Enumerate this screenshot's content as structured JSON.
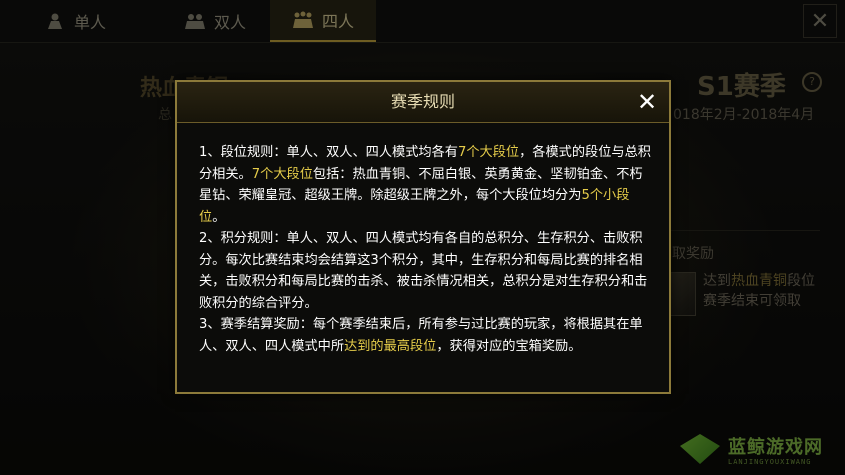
{
  "tabs": [
    {
      "label": "单人",
      "icon": "single-player-icon"
    },
    {
      "label": "双人",
      "icon": "duo-players-icon"
    },
    {
      "label": "四人",
      "icon": "squad-players-icon",
      "active": true
    }
  ],
  "close_main": "✕",
  "background": {
    "rank_title": "热血青铜",
    "rank_sub": "总",
    "season_title": "S1赛季",
    "season_info_icon": "?",
    "season_dates": "018年2月-2018年4月",
    "reward_head": "取奖励",
    "reward_line1_prefix": "达到",
    "reward_line1_highlight": "热血青铜",
    "reward_line1_suffix": "段位",
    "reward_line2": "赛季结束可领取"
  },
  "modal": {
    "title": "赛季规则",
    "close": "✕",
    "rules": [
      {
        "parts": [
          {
            "t": "1、段位规则：单人、双人、四人模式均各有"
          },
          {
            "t": "7个大段位",
            "hl": true
          },
          {
            "t": "，各模式的段位与总积分相关。"
          },
          {
            "t": "7个大段位",
            "hl": true
          },
          {
            "t": "包括：热血青铜、不屈白银、英勇黄金、坚韧铂金、不朽星钻、荣耀皇冠、超级王牌。除超级王牌之外，每个大段位均分为"
          },
          {
            "t": "5个小段位",
            "hl": true
          },
          {
            "t": "。"
          }
        ]
      },
      {
        "parts": [
          {
            "t": "2、积分规则：单人、双人、四人模式均有各自的总积分、生存积分、击败积分。每次比赛结束均会结算这3个积分，其中，生存积分和每局比赛的排名相关，击败积分和每局比赛的击杀、被击杀情况相关，总积分是对生存积分和击败积分的综合评分。"
          }
        ]
      },
      {
        "parts": [
          {
            "t": "3、赛季结算奖励：每个赛季结束后，所有参与过比赛的玩家，将根据其在单人、双人、四人模式中所"
          },
          {
            "t": "达到的最高段位",
            "hl": true
          },
          {
            "t": "，获得对应的宝箱奖励。"
          }
        ]
      }
    ]
  },
  "watermark": {
    "text": "蓝鲸游戏网",
    "sub": "LANJINGYOUXIWANG"
  },
  "colors": {
    "highlight": "#e5cc4a",
    "border_gold": "#8c7a3a",
    "active_tab": "#c9a93e"
  }
}
